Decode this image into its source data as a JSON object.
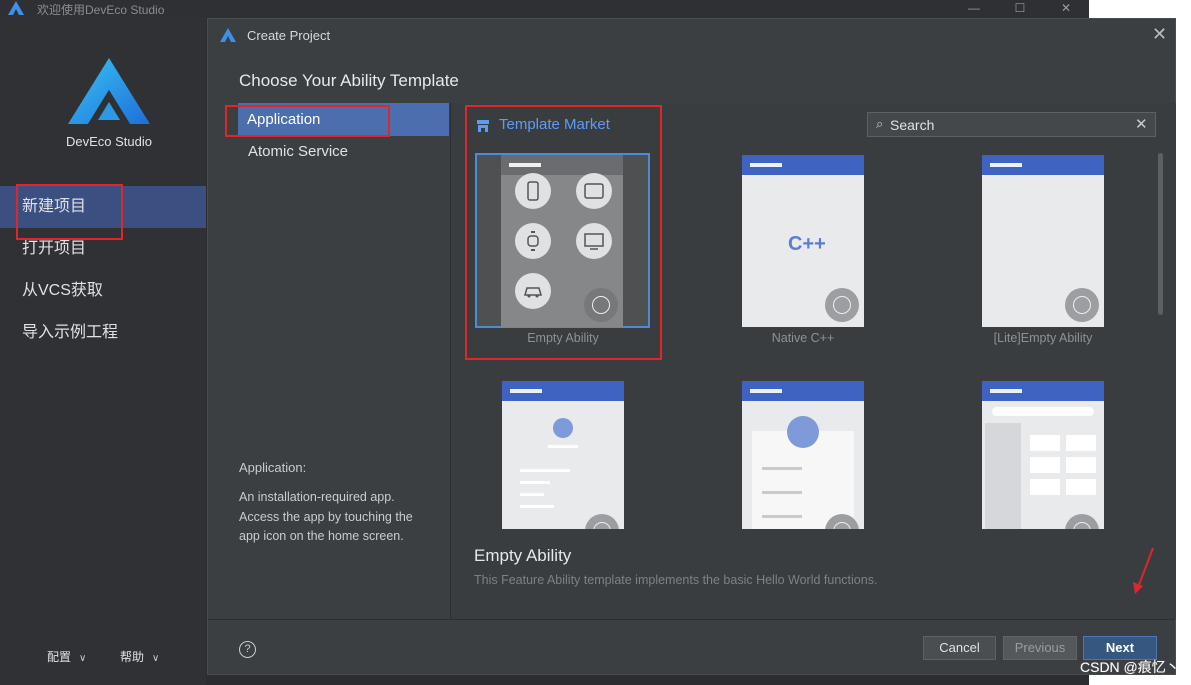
{
  "welcome": {
    "window_title": "欢迎使用DevEco Studio",
    "window_controls": [
      "—",
      "☐",
      "✕"
    ],
    "brand": "DevEco Studio",
    "nav": [
      {
        "label": "新建项目",
        "selected": true
      },
      {
        "label": "打开项目",
        "selected": false
      },
      {
        "label": "从VCS获取",
        "selected": false
      },
      {
        "label": "导入示例工程",
        "selected": false
      }
    ],
    "footer": {
      "config": "配置",
      "help": "帮助"
    }
  },
  "dialog": {
    "title": "Create Project",
    "heading": "Choose Your Ability Template",
    "categories": [
      {
        "label": "Application",
        "selected": true
      },
      {
        "label": "Atomic Service",
        "selected": false
      }
    ],
    "description": {
      "title": "Application:",
      "text": "An installation-required app. Access the app by touching the app icon on the home screen."
    },
    "market_label": "Template Market",
    "search": {
      "placeholder": "Search"
    },
    "templates": [
      {
        "label": "Empty Ability",
        "selected": true
      },
      {
        "label": "Native C++",
        "selected": false
      },
      {
        "label": "[Lite]Empty Ability",
        "selected": false
      },
      {
        "label": "",
        "selected": false
      },
      {
        "label": "",
        "selected": false
      },
      {
        "label": "",
        "selected": false
      }
    ],
    "cpp_glyph": "C++",
    "selected_template": {
      "title": "Empty Ability",
      "description": "This Feature Ability template implements the basic Hello World functions."
    },
    "buttons": {
      "help": "?",
      "cancel": "Cancel",
      "previous": "Previous",
      "next": "Next"
    }
  },
  "watermark": "CSDN @痕忆丶",
  "colors": {
    "accent": "#4b6eaf",
    "highlight": "#e0262b",
    "link": "#5b9df1"
  }
}
